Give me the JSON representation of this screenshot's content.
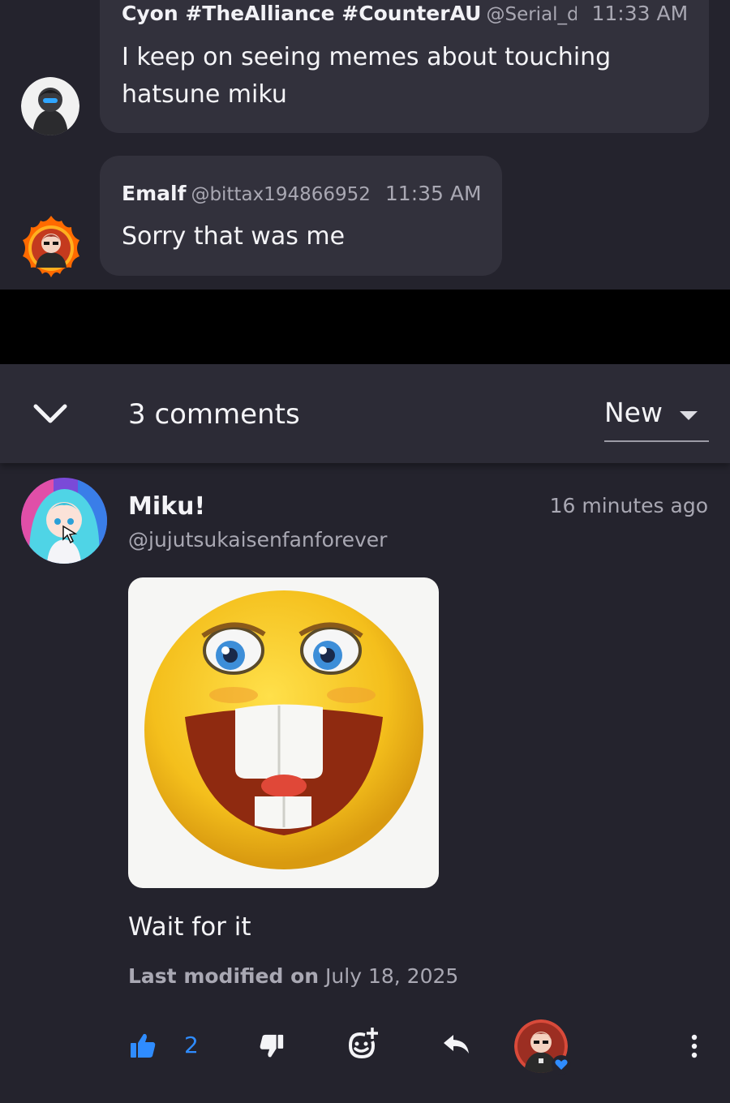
{
  "chat": {
    "messages": [
      {
        "name": "Cyon #TheAlliance #CounterAU",
        "handle": "@Serial_de",
        "time": "11:33 AM",
        "text_line1": "I keep on seeing memes about touching",
        "text_line2": "hatsune miku"
      },
      {
        "name": "Emalf",
        "handle": "@bittax194866952",
        "time": "11:35 AM",
        "text_line1": "Sorry that was me"
      }
    ]
  },
  "comments_header": {
    "collapse_icon": "chevron-down-icon",
    "count_label": "3 comments",
    "sort": {
      "selected": "New",
      "icon": "caret-down-icon"
    }
  },
  "comment": {
    "author_name": "Miku!",
    "author_handle": "@jujutsukaisenfanforever",
    "time_ago": "16 minutes ago",
    "image": "laughing-emoji-image",
    "text": "Wait for it",
    "modified_prefix": "Last modified on",
    "modified_date": "July 18, 2025",
    "actions": {
      "like_count": "2",
      "like_icon": "thumbs-up-icon",
      "dislike_icon": "thumbs-down-icon",
      "react_icon": "add-reaction-icon",
      "reply_icon": "reply-icon",
      "more_icon": "more-vertical-icon"
    }
  },
  "colors": {
    "background": "#24232d",
    "bubble": "#32313c",
    "header": "#2c2b36",
    "accent_blue": "#2f8cff",
    "muted_text": "#a9a8b3"
  }
}
